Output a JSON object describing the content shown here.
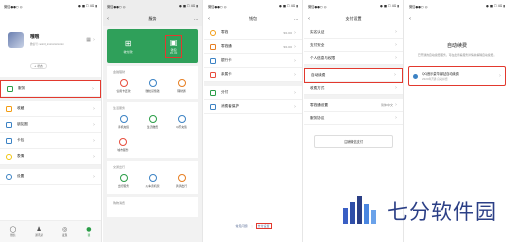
{
  "me": {
    "status_left": "微信●●○ ◎",
    "status_right": "● ■ ☐ 4G  ▮",
    "username": "哦哦",
    "wechat_id": "微信号: wxid_xxxxxxxxxxx",
    "status_btn": "+ 状态",
    "menu": [
      {
        "label": "服务",
        "color": "#2a9d47"
      },
      {
        "label": "收藏",
        "color": "#f39c12"
      },
      {
        "label": "朋友圈",
        "color": "#3b82c4"
      },
      {
        "label": "卡包",
        "color": "#3b82c4"
      },
      {
        "label": "表情",
        "color": "#f1c40f"
      },
      {
        "label": "设置",
        "color": "#3b82c4"
      }
    ],
    "tabs": [
      "微信",
      "通讯录",
      "发现",
      "我"
    ]
  },
  "services": {
    "title": "服务",
    "pay_label": "收付款",
    "wallet_label": "钱包",
    "wallet_amount": "¥0.00",
    "sections": [
      {
        "title": "金融理财",
        "items": [
          "信用卡还款",
          "微粒贷借钱",
          "理财通"
        ]
      },
      {
        "title": "生活服务",
        "items": [
          "手机充值",
          "生活缴费",
          "Q币充值",
          "城市服务",
          "腾讯公益",
          "医疗健康"
        ]
      },
      {
        "title": "交通出行",
        "items": [
          "出行服务",
          "火车票机票",
          "滴滴出行"
        ]
      },
      {
        "title": "购物消费",
        "items": []
      }
    ]
  },
  "wallet": {
    "title": "钱包",
    "rows": [
      {
        "label": "零钱",
        "value": "¥0.00"
      },
      {
        "label": "零钱通",
        "value": "¥0.00"
      },
      {
        "label": "银行卡",
        "value": ""
      },
      {
        "label": "亲属卡",
        "value": ""
      },
      {
        "label": "分付",
        "value": ""
      },
      {
        "label": "消费者保护",
        "value": ""
      }
    ],
    "footer_left": "常见问题",
    "footer_right": "支付设置"
  },
  "pay_settings": {
    "title": "支付设置",
    "rows": [
      "实名认证",
      "支付安全",
      "个人信息与权限",
      "自动续费",
      "收费方式",
      "零钱通设置",
      "服务协议"
    ],
    "language_value": "简体中文",
    "delete_btn": "注销微信支付"
  },
  "auto_renew": {
    "title": "自动续费",
    "desc": "已开通的自动续费服务，可在此查看服务详情并解除自动续费。",
    "item_title": "QQ音乐豪华绿钻自动续费",
    "item_sub": "2020年开通 自动扣费"
  },
  "watermark": {
    "text": "七分软件园"
  }
}
